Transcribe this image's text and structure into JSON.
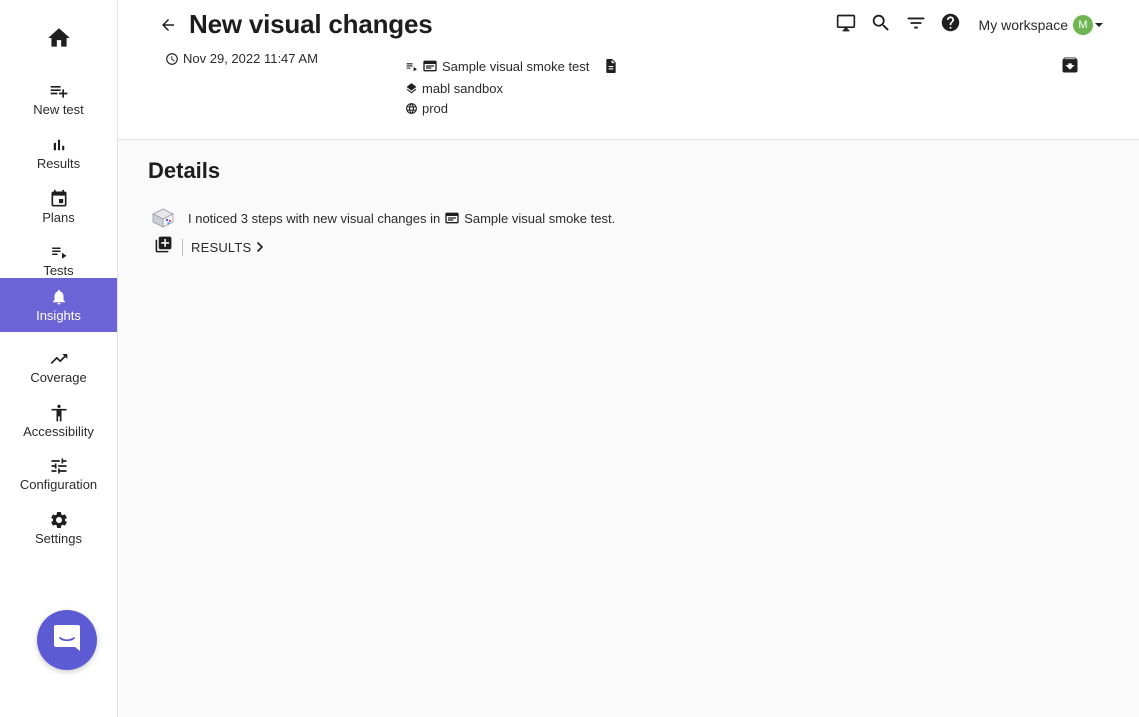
{
  "sidebar": {
    "home_icon": "home-icon",
    "items": [
      {
        "label": "New test",
        "icon": "playlist-add-icon"
      },
      {
        "label": "Results",
        "icon": "bar-chart-icon"
      },
      {
        "label": "Plans",
        "icon": "calendar-icon"
      },
      {
        "label": "Tests",
        "icon": "playlist-icon"
      },
      {
        "label": "Insights",
        "icon": "bell-icon",
        "active": true
      },
      {
        "label": "Coverage",
        "icon": "trending-up-icon"
      },
      {
        "label": "Accessibility",
        "icon": "accessibility-icon"
      },
      {
        "label": "Configuration",
        "icon": "tune-icon"
      },
      {
        "label": "Settings",
        "icon": "gear-icon"
      }
    ],
    "active_color": "#6b63d6"
  },
  "header": {
    "title": "New visual changes",
    "timestamp": "Nov 29, 2022 11:47 AM",
    "test_name": "Sample visual smoke test",
    "workspace_env": "mabl sandbox",
    "environment": "prod",
    "workspace_label": "My workspace",
    "avatar_initial": "M",
    "avatar_color": "#6fb552"
  },
  "main": {
    "section_title": "Details",
    "insight_text": "I noticed 3 steps with new visual changes in",
    "insight_test_link": "Sample visual smoke test.",
    "results_label": "RESULTS"
  },
  "chat": {
    "icon": "chat-bubble-icon",
    "color": "#5d5bd4"
  }
}
